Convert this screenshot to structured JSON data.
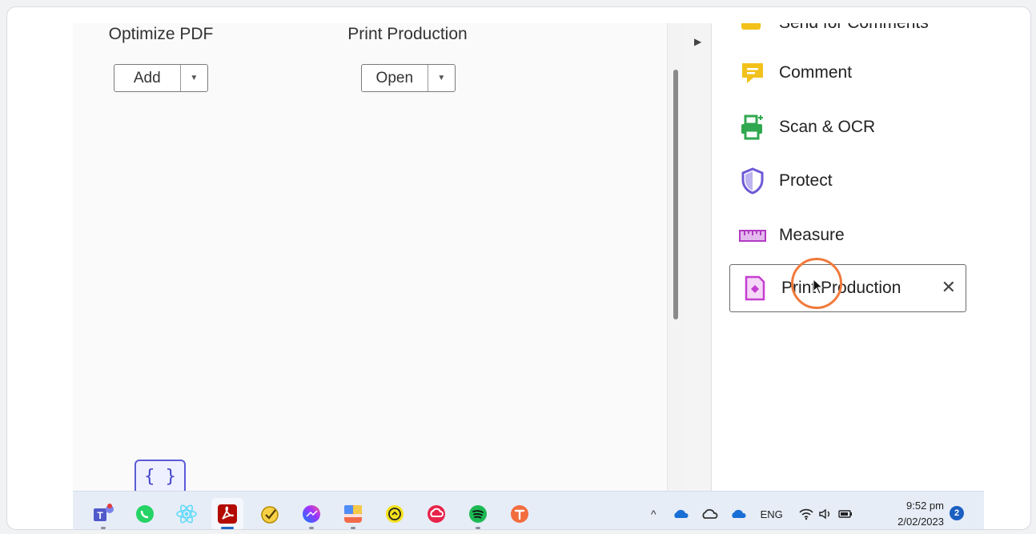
{
  "tools_grid": {
    "optimize": {
      "title": "Optimize PDF",
      "button": "Add"
    },
    "print": {
      "title": "Print Production",
      "button": "Open"
    }
  },
  "right_panel": {
    "partial_item": "Send for Comments",
    "items": [
      {
        "label": "Comment",
        "icon": "comment-icon"
      },
      {
        "label": "Scan & OCR",
        "icon": "scan-ocr-icon"
      },
      {
        "label": "Protect",
        "icon": "shield-icon"
      },
      {
        "label": "Measure",
        "icon": "ruler-icon"
      },
      {
        "label": "Print Production",
        "icon": "print-production-icon"
      }
    ],
    "close_glyph": "✕"
  },
  "taskbar": {
    "apps": [
      "Microsoft Teams",
      "WhatsApp",
      "React",
      "Adobe Acrobat",
      "Sticky app",
      "Messenger",
      "Sticky Notes",
      "Timer",
      "Creative Cloud",
      "Spotify",
      "Typora"
    ],
    "tray": {
      "language": "ENG"
    },
    "clock": {
      "time": "9:52 pm",
      "date": "2/02/2023"
    },
    "notification_count": "2"
  },
  "colors": {
    "accent_blue": "#1a5fc1",
    "cursor_ring": "#f07a3c",
    "comment_yellow": "#f2c21b",
    "scan_green": "#2fa84f",
    "protect_purple": "#6d5ad6",
    "print_magenta": "#c43fd0"
  },
  "badge": "{ }"
}
